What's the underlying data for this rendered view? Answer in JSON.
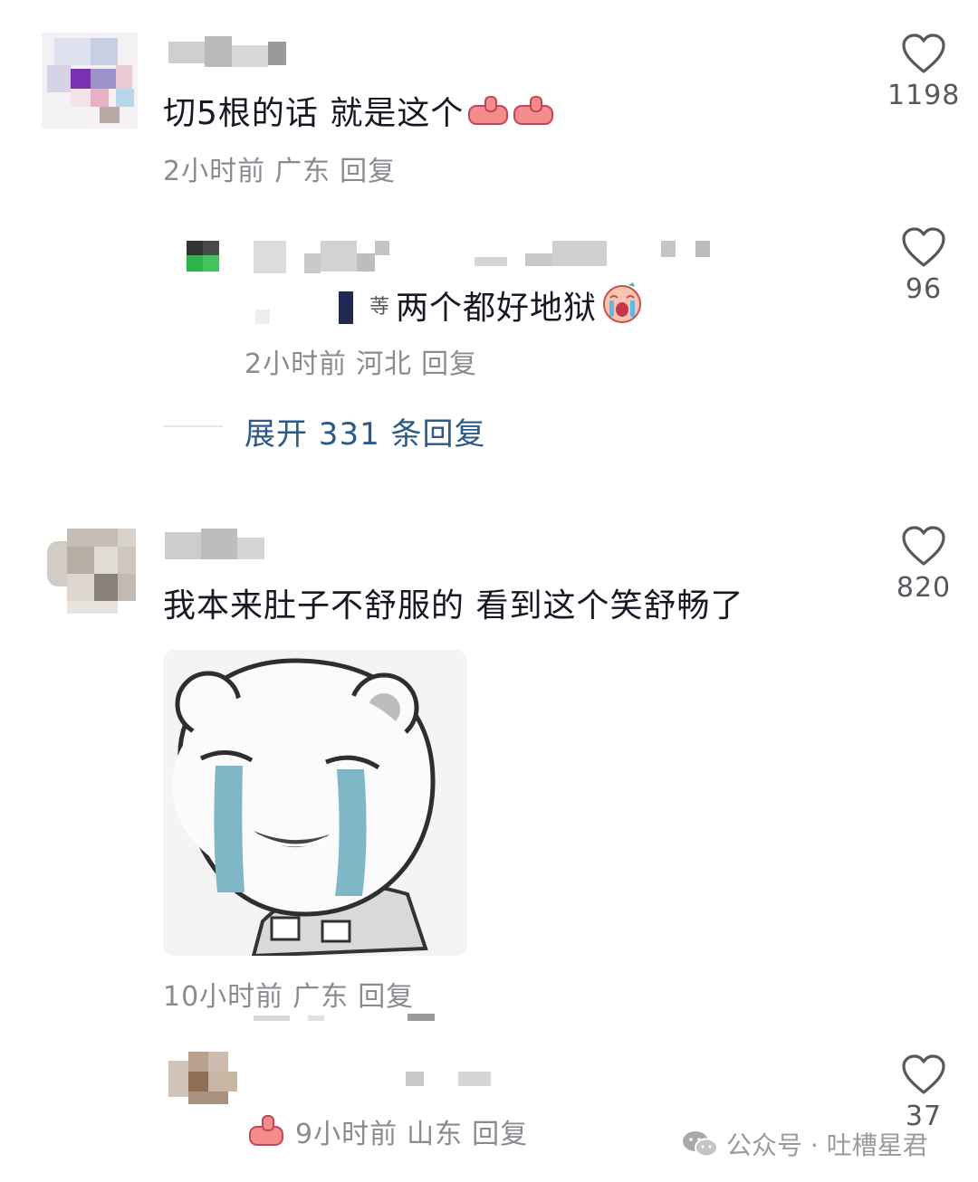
{
  "comments": [
    {
      "text": "切5根的话  就是这个",
      "emoji": "thumbs-up-icon",
      "time": "2小时前",
      "location": "广东",
      "reply": "回复",
      "likes": "1198"
    },
    {
      "reply_text": "两个都好地狱",
      "emoji": "crying-face-icon",
      "time": "2小时前",
      "location": "河北",
      "reply": "回复",
      "likes": "96",
      "expand_label": "展开 331 条回复"
    },
    {
      "text": "我本来肚子不舒服的 看到这个笑舒畅了",
      "sticker": "crying-bear-sticker",
      "time": "10小时前",
      "location": "广东",
      "reply": "回复",
      "likes": "820"
    },
    {
      "emoji": "thumbs-up-icon",
      "time": "9小时前",
      "location": "山东",
      "reply": "回复",
      "likes": "37"
    }
  ],
  "watermark": {
    "icon": "wechat-icon",
    "text": "公众号 · 吐槽星君"
  },
  "colors": {
    "text": "#161823",
    "meta": "#8a8b91",
    "link": "#2b5a8a",
    "heart": "#57585e"
  }
}
